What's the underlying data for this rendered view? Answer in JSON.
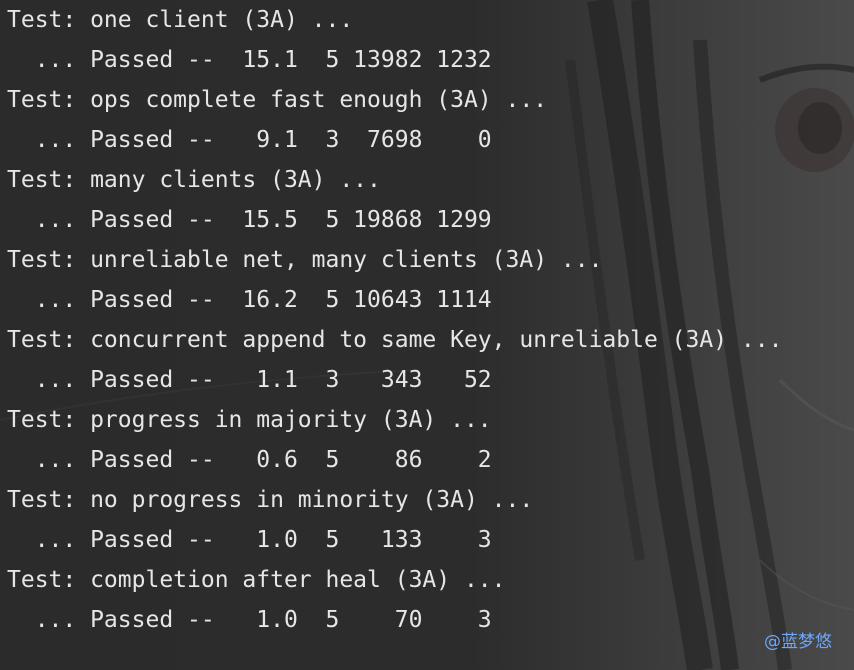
{
  "terminal": {
    "entries": [
      {
        "test": "Test: one client (3A) ...",
        "result": "  ... Passed --  15.1  5 13982 1232"
      },
      {
        "test": "Test: ops complete fast enough (3A) ...",
        "result": "  ... Passed --   9.1  3  7698    0"
      },
      {
        "test": "Test: many clients (3A) ...",
        "result": "  ... Passed --  15.5  5 19868 1299"
      },
      {
        "test": "Test: unreliable net, many clients (3A) ...",
        "result": "  ... Passed --  16.2  5 10643 1114"
      },
      {
        "test": "Test: concurrent append to same Key, unreliable (3A) ...",
        "result": "  ... Passed --   1.1  3   343   52"
      },
      {
        "test": "Test: progress in majority (3A) ...",
        "result": "  ... Passed --   0.6  5    86    2"
      },
      {
        "test": "Test: no progress in minority (3A) ...",
        "result": "  ... Passed --   1.0  5   133    3"
      },
      {
        "test": "Test: completion after heal (3A) ...",
        "result": "  ... Passed --   1.0  5    70    3"
      }
    ]
  },
  "watermark": "@蓝梦悠",
  "colors": {
    "background": "#2b2b2b",
    "text": "#e6e6e6",
    "watermark": "#6aa8ff"
  }
}
